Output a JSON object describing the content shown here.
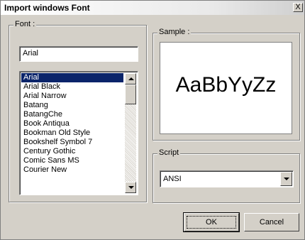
{
  "window": {
    "title": "Import windows Font",
    "close_label": "X"
  },
  "font_group": {
    "legend": "Font :",
    "input_value": "Arial",
    "items": [
      "Arial",
      "Arial Black",
      "Arial Narrow",
      "Batang",
      "BatangChe",
      "Book Antiqua",
      "Bookman Old Style",
      "Bookshelf Symbol 7",
      "Century Gothic",
      "Comic Sans MS",
      "Courier New"
    ],
    "selected_index": 0
  },
  "sample_group": {
    "legend": "Sample :",
    "text": "AaBbYyZz"
  },
  "script_group": {
    "legend": "Script",
    "value": "ANSI"
  },
  "buttons": {
    "ok": "OK",
    "cancel": "Cancel"
  },
  "colors": {
    "selection": "#0a246a",
    "face": "#d4d0c8"
  }
}
